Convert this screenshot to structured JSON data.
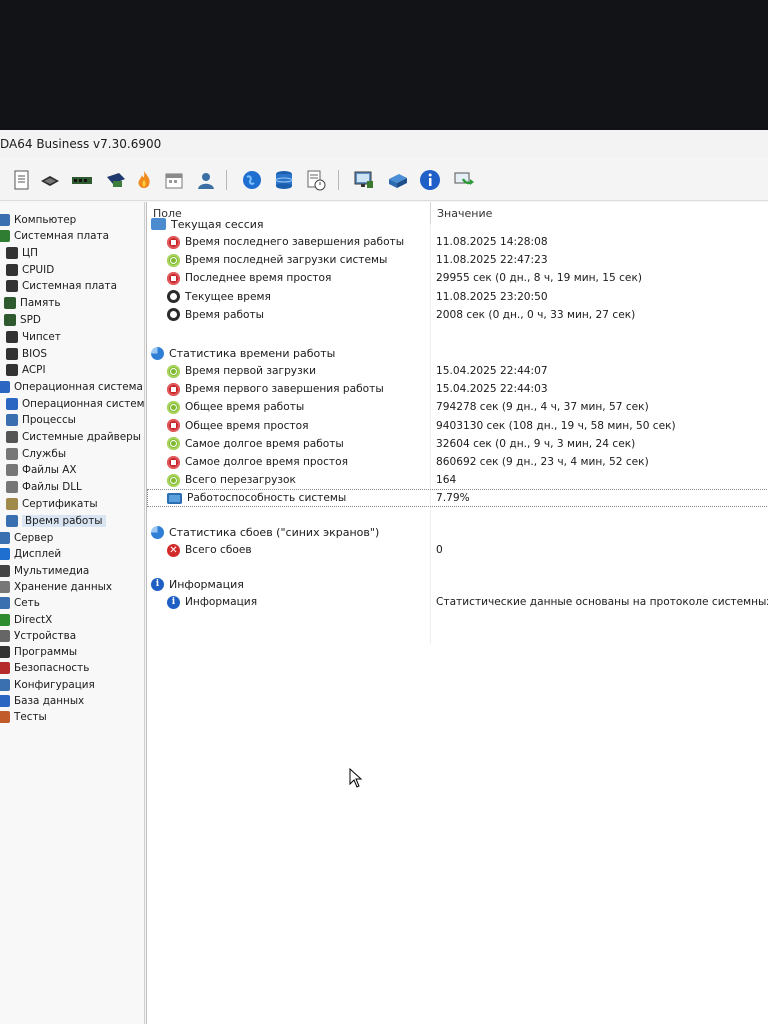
{
  "window": {
    "title": "DA64 Business v7.30.6900"
  },
  "toolbar": {
    "icons": [
      "report-icon",
      "motherboard-icon",
      "memory-icon",
      "processor-icon",
      "flame-icon",
      "calendar-icon",
      "users-icon",
      "globe-icon",
      "database-icon",
      "schedule-icon",
      "monitor-icon",
      "network-icon",
      "info-icon",
      "update-icon"
    ]
  },
  "tree": {
    "items": [
      {
        "label": "Компьютер",
        "icon": "computer-icon"
      },
      {
        "label": "Системная плата",
        "icon": "motherboard-icon"
      },
      {
        "label": "ЦП",
        "icon": "cpu-icon"
      },
      {
        "label": "CPUID",
        "icon": "cpuid-icon"
      },
      {
        "label": "Системная плата",
        "icon": "board-icon"
      },
      {
        "label": "Память",
        "icon": "memory-icon"
      },
      {
        "label": "SPD",
        "icon": "spd-icon"
      },
      {
        "label": "Чипсет",
        "icon": "chipset-icon"
      },
      {
        "label": "BIOS",
        "icon": "bios-icon"
      },
      {
        "label": "ACPI",
        "icon": "acpi-icon"
      },
      {
        "label": "Операционная система",
        "icon": "os-icon"
      },
      {
        "label": "Операционная система",
        "icon": "windows-icon"
      },
      {
        "label": "Процессы",
        "icon": "processes-icon"
      },
      {
        "label": "Системные драйверы",
        "icon": "drivers-icon"
      },
      {
        "label": "Службы",
        "icon": "services-icon"
      },
      {
        "label": "Файлы AX",
        "icon": "ax-files-icon"
      },
      {
        "label": "Файлы DLL",
        "icon": "dll-files-icon"
      },
      {
        "label": "Сертификаты",
        "icon": "certificates-icon"
      },
      {
        "label": "Время работы",
        "icon": "uptime-icon"
      },
      {
        "label": "Сервер",
        "icon": "server-icon"
      },
      {
        "label": "Дисплей",
        "icon": "display-icon"
      },
      {
        "label": "Мультимедиа",
        "icon": "multimedia-icon"
      },
      {
        "label": "Хранение данных",
        "icon": "storage-icon"
      },
      {
        "label": "Сеть",
        "icon": "network-icon"
      },
      {
        "label": "DirectX",
        "icon": "directx-icon"
      },
      {
        "label": "Устройства",
        "icon": "devices-icon"
      },
      {
        "label": "Программы",
        "icon": "programs-icon"
      },
      {
        "label": "Безопасность",
        "icon": "security-icon"
      },
      {
        "label": "Конфигурация",
        "icon": "config-icon"
      },
      {
        "label": "База данных",
        "icon": "database-icon"
      },
      {
        "label": "Тесты",
        "icon": "tests-icon"
      }
    ]
  },
  "list": {
    "col_field": "Поле",
    "col_value": "Значение",
    "sections": [
      {
        "title": "Текущая сессия",
        "icon": "session-icon",
        "rows": [
          {
            "field": "Время последнего завершения работы",
            "value": "11.08.2025 14:28:08",
            "icon": "stop-icon"
          },
          {
            "field": "Время последней загрузки системы",
            "value": "11.08.2025 22:47:23",
            "icon": "start-icon"
          },
          {
            "field": "Последнее время простоя",
            "value": "29955 сек (0 дн., 8 ч, 19 мин, 15 сек)",
            "icon": "stop-icon"
          },
          {
            "field": "Текущее время",
            "value": "11.08.2025 23:20:50",
            "icon": "clock-icon"
          },
          {
            "field": "Время работы",
            "value": "2008 сек (0 дн., 0 ч, 33 мин, 27 сек)",
            "icon": "clock-icon"
          }
        ]
      },
      {
        "title": "Статистика времени работы",
        "icon": "pie-chart-icon",
        "rows": [
          {
            "field": "Время первой загрузки",
            "value": "15.04.2025 22:44:07",
            "icon": "start-icon"
          },
          {
            "field": "Время первого завершения работы",
            "value": "15.04.2025 22:44:03",
            "icon": "stop-icon"
          },
          {
            "field": "Общее время работы",
            "value": "794278 сек (9 дн., 4 ч, 37 мин, 57 сек)",
            "icon": "start-icon"
          },
          {
            "field": "Общее время простоя",
            "value": "9403130 сек (108 дн., 19 ч, 58 мин, 50 сек)",
            "icon": "stop-icon"
          },
          {
            "field": "Самое долгое время работы",
            "value": "32604 сек (0 дн., 9 ч, 3 мин, 24 сек)",
            "icon": "start-icon"
          },
          {
            "field": "Самое долгое время простоя",
            "value": "860692 сек (9 дн., 23 ч, 4 мин, 52 сек)",
            "icon": "stop-icon"
          },
          {
            "field": "Всего перезагрузок",
            "value": "164",
            "icon": "start-icon"
          },
          {
            "field": "Работоспособность системы",
            "value": "7.79%",
            "icon": "monitor-icon"
          }
        ]
      },
      {
        "title": "Статистика сбоев (\"синих экранов\")",
        "icon": "pie-chart-icon",
        "rows": [
          {
            "field": "Всего сбоев",
            "value": "0",
            "icon": "error-icon"
          }
        ]
      },
      {
        "title": "Информация",
        "icon": "info-icon",
        "rows": [
          {
            "field": "Информация",
            "value": "Статистические данные основаны на протоколе системных соб",
            "icon": "info-icon"
          }
        ]
      }
    ]
  }
}
